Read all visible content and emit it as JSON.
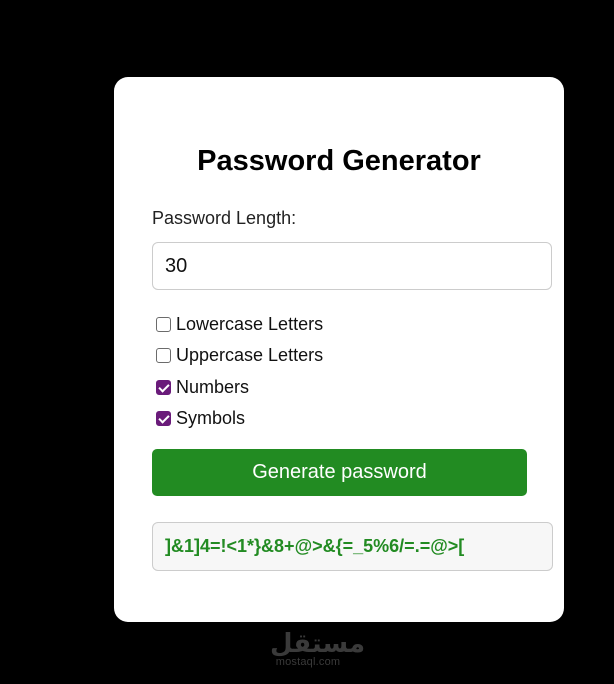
{
  "app": {
    "title": "Password Generator"
  },
  "length": {
    "label": "Password Length:",
    "value": "30"
  },
  "options": [
    {
      "label": "Lowercase Letters",
      "checked": false
    },
    {
      "label": "Uppercase Letters",
      "checked": false
    },
    {
      "label": "Numbers",
      "checked": true
    },
    {
      "label": "Symbols",
      "checked": true
    }
  ],
  "generate_button": {
    "label": "Generate password"
  },
  "output": {
    "password": "]&1]4=!<1*}&8+@>&{=_5%6/=.=@>["
  },
  "watermark": {
    "logo": "مستقل",
    "text": "mostaql.com"
  },
  "colors": {
    "page_background": "#000000",
    "card_background": "#ffffff",
    "button_background": "#228b22",
    "password_text": "#228b22",
    "checkbox_accent": "#6a1b7a"
  }
}
